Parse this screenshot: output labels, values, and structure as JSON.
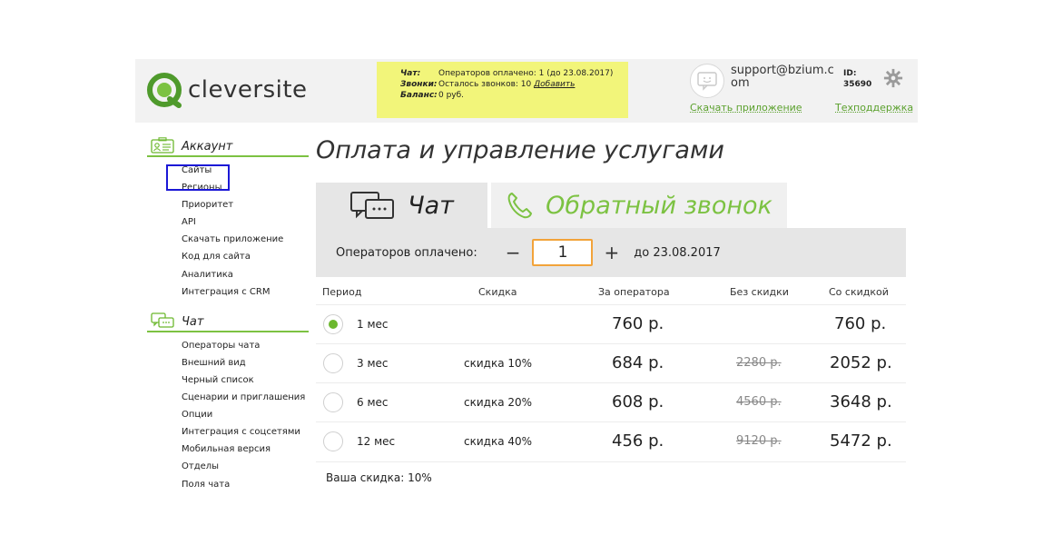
{
  "header": {
    "logo_text": "cleversite",
    "notice": {
      "chat_label": "Чат:",
      "chat_text": "Операторов оплачено: 1 (до 23.08.2017)",
      "calls_label": "Звонки:",
      "calls_text": "Осталось звонков: 10",
      "calls_link": "Добавить",
      "balance_label": "Баланс:",
      "balance_text": "0 руб."
    },
    "email": "support@bzium.com",
    "id_label": "ID:",
    "id_value": "35690",
    "download_link": "Скачать приложение",
    "support_link": "Техподдержка"
  },
  "sidebar": {
    "account_title": "Аккаунт",
    "account_items": [
      "Сайты",
      "Регионы",
      "Приоритет",
      "API",
      "Скачать приложение",
      "Код для сайта",
      "Аналитика",
      "Интеграция с CRM"
    ],
    "chat_title": "Чат",
    "chat_items": [
      "Операторы чата",
      "Внешний вид",
      "Черный список",
      "Сценарии и приглашения",
      "Опции",
      "Интеграция с соцсетями",
      "Мобильная версия",
      "Отделы",
      "Поля чата"
    ]
  },
  "main": {
    "title": "Оплата и управление услугами",
    "tabs": [
      {
        "label": "Чат"
      },
      {
        "label": "Обратный звонок"
      }
    ],
    "operators_label": "Операторов оплачено:",
    "minus": "−",
    "plus": "+",
    "quantity": "1",
    "until": "до 23.08.2017",
    "columns": [
      "Период",
      "Скидка",
      "За оператора",
      "Без скидки",
      "Со скидкой"
    ],
    "rows": [
      {
        "period": "1 мес",
        "discount": "",
        "per_operator": "760 р.",
        "without": "",
        "with": "760 р.",
        "selected": true
      },
      {
        "period": "3 мес",
        "discount": "скидка 10%",
        "per_operator": "684 р.",
        "without": "2280 р.",
        "with": "2052 р.",
        "selected": false
      },
      {
        "period": "6 мес",
        "discount": "скидка 20%",
        "per_operator": "608 р.",
        "without": "4560 р.",
        "with": "3648 р.",
        "selected": false
      },
      {
        "period": "12 мес",
        "discount": "скидка 40%",
        "per_operator": "456 р.",
        "without": "9120 р.",
        "with": "5472 р.",
        "selected": false
      }
    ],
    "your_discount": "Ваша скидка: 10%"
  },
  "colors": {
    "accent": "#7cc242",
    "notice": "#f2f57a",
    "highlight": "#1b18d6",
    "qty_border": "#f2a33a"
  }
}
